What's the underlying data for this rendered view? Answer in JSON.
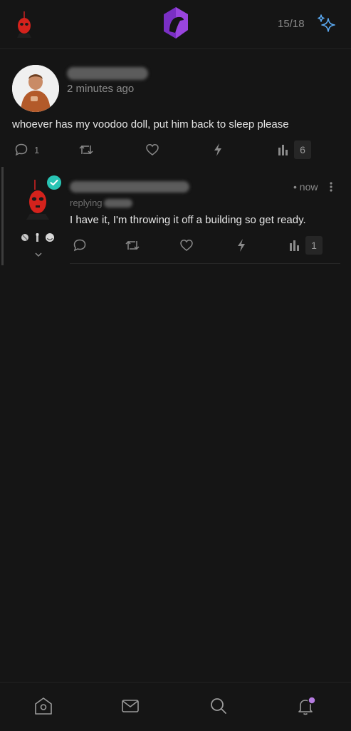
{
  "header": {
    "counter": "15/18",
    "logo_icon": "app-logo-icon",
    "sparkle_icon": "sparkle-icon"
  },
  "post": {
    "time": "2 minutes ago",
    "text": "whoever has my voodoo doll, put him back to sleep please",
    "reply_count": "1",
    "views": "6"
  },
  "reply": {
    "time": "• now",
    "replying": "replying",
    "text": "I have it, I'm throwing it off a building so get ready.",
    "views": "1"
  },
  "nav": {
    "items": [
      "home-icon",
      "messages-icon",
      "search-icon",
      "notifications-icon"
    ],
    "badge_color": "#b57be0"
  },
  "colors": {
    "background": "#151515",
    "accent_purple": "#8a3bd1",
    "sparkle_blue": "#5aa8f0",
    "verified": "#28c4b4"
  }
}
